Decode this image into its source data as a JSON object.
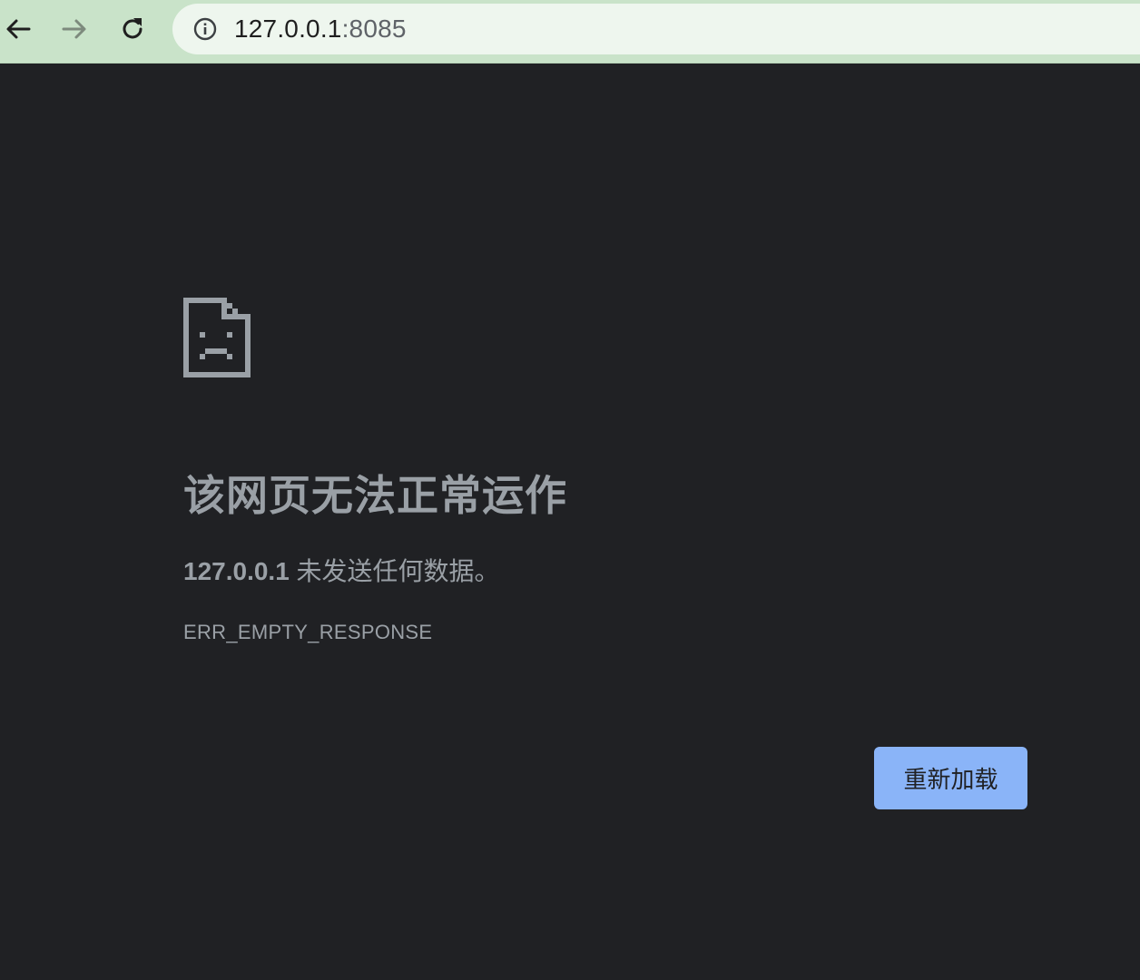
{
  "browser": {
    "back_icon": "arrow-left-icon",
    "forward_icon": "arrow-right-icon",
    "reload_icon": "reload-icon",
    "site_info_icon": "info-icon",
    "url_host": "127.0.0.1",
    "url_port": ":8085",
    "colors": {
      "toolbar": "#c9e3c9",
      "omnibox": "#eef6ee"
    }
  },
  "error_page": {
    "icon": "sad-document-icon",
    "title": "该网页无法正常运作",
    "subtitle_host": "127.0.0.1",
    "subtitle_message": " 未发送任何数据。",
    "error_code": "ERR_EMPTY_RESPONSE",
    "reload_label": "重新加载",
    "colors": {
      "background": "#202124",
      "text": "#9aa0a6",
      "button": "#8ab4f8"
    }
  }
}
